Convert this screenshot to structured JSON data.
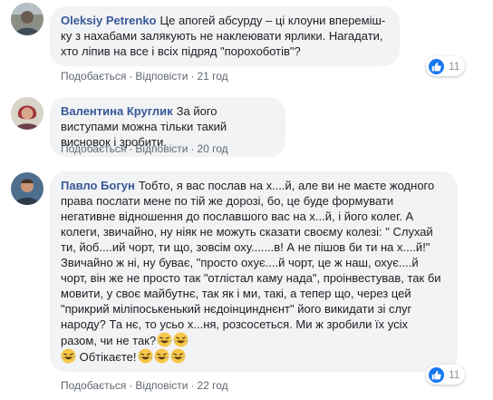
{
  "comments": [
    {
      "author": "Oleksiy Petrenko",
      "text": "Це апогей абсурду – ці клоуни впереміш­ку з нахабами залякують не наклеювати ярлики. Нагадати, хто ліпив на все і всіх підряд \"порохоботів\"?",
      "like": "Подобається",
      "reply": "Відповісти",
      "time": "21 год",
      "reaction_count": "11"
    },
    {
      "author": "Валентина Круглик",
      "text": "За його виступами можна тільки такий висновок і зробити.",
      "like": "Подобається",
      "reply": "Відповісти",
      "time": "20 год"
    },
    {
      "author": "Павло Богун",
      "text": "Тобто, я вас послав на х....й, але ви не маєте жодного права послати мене по тій же дорозі, бо, це буде формувати негативне відношення до пославшого вас на х...й, і його колег. А колеги, звичайно, ну ніяк не можуть сказати своєму колезі: \" Слухай ти, йоб....ий чорт, ти що, зовсім оху.......в! А не пішов би ти на х....й!\" Звичайно ж ні, ну буває, \"просто охує....й чорт, це ж наш, охує....й чорт, він же не просто так \"отлістал каму нада\", проінвестував, так би мовити, у своє майбутнє, так як і ми, такі, а тепер що, через цей \"прикрий міліпоськенький нєдоінцинднєнт\" його викидати зі слуг народу? Та нє, то усьо х...ня, розсосеться. Ми ж зробили їх усіх разом, чи не так?",
      "text_end": "Обтікаєте!",
      "like": "Подобається",
      "reply": "Відповісти",
      "time": "22 год",
      "reaction_count": "11"
    }
  ],
  "icons": {
    "like": "like-thumb-icon",
    "laugh": "laughing-emoji-icon"
  },
  "colors": {
    "author": "#385898",
    "bubble": "#f2f3f5",
    "like_blue": "#1877f2"
  }
}
